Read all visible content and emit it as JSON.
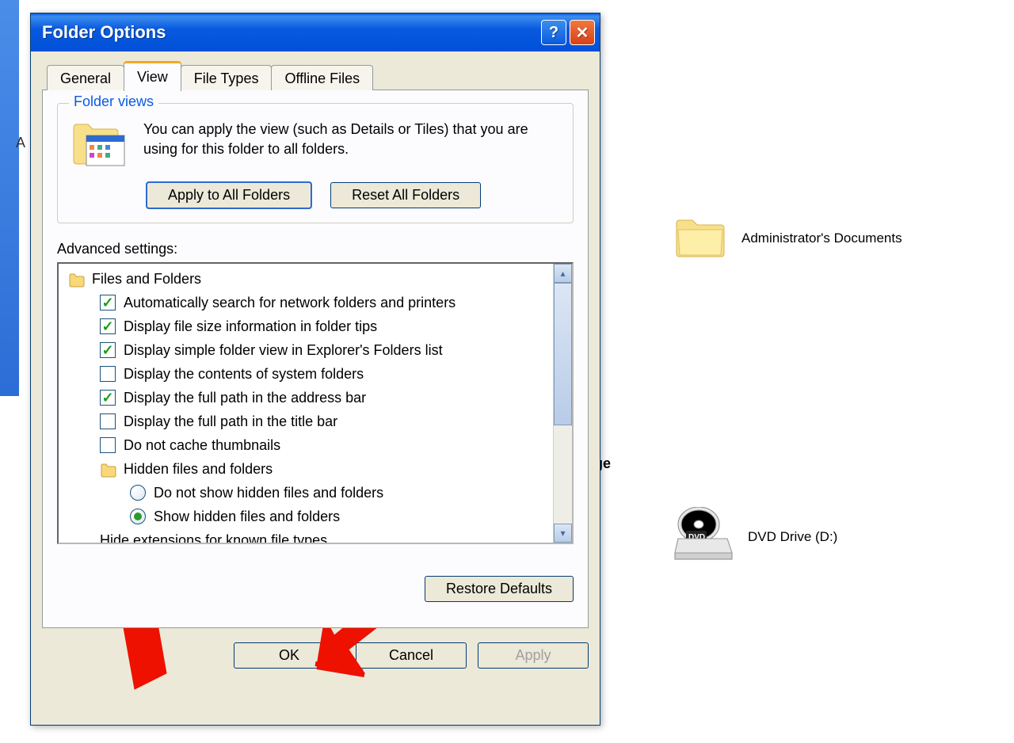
{
  "desktop": {
    "admin_docs_label": "Administrator's Documents",
    "storage_partial": "ge",
    "dvd_label": "DVD Drive (D:)",
    "side_label": "A"
  },
  "dialog": {
    "title": "Folder Options",
    "tabs": {
      "general": "General",
      "view": "View",
      "filetypes": "File Types",
      "offline": "Offline Files"
    },
    "folder_views": {
      "group_title": "Folder views",
      "description": "You can apply the view (such as Details or Tiles) that you are using for this folder to all folders.",
      "apply_btn": "Apply to All Folders",
      "reset_btn": "Reset All Folders"
    },
    "advanced_label": "Advanced settings:",
    "tree": {
      "files_and_folders": "Files and Folders",
      "items": [
        {
          "label": "Automatically search for network folders and printers",
          "checked": true
        },
        {
          "label": "Display file size information in folder tips",
          "checked": true
        },
        {
          "label": "Display simple folder view in Explorer's Folders list",
          "checked": true
        },
        {
          "label": "Display the contents of system folders",
          "checked": false
        },
        {
          "label": "Display the full path in the address bar",
          "checked": true
        },
        {
          "label": "Display the full path in the title bar",
          "checked": false
        },
        {
          "label": "Do not cache thumbnails",
          "checked": false
        }
      ],
      "hidden_group": "Hidden files and folders",
      "hidden_options": [
        {
          "label": "Do not show hidden files and folders",
          "selected": false
        },
        {
          "label": "Show hidden files and folders",
          "selected": true
        }
      ],
      "hide_ext": {
        "label": "Hide extensions for known file types",
        "checked": false
      }
    },
    "restore_defaults": "Restore Defaults",
    "buttons": {
      "ok": "OK",
      "cancel": "Cancel",
      "apply": "Apply"
    }
  }
}
